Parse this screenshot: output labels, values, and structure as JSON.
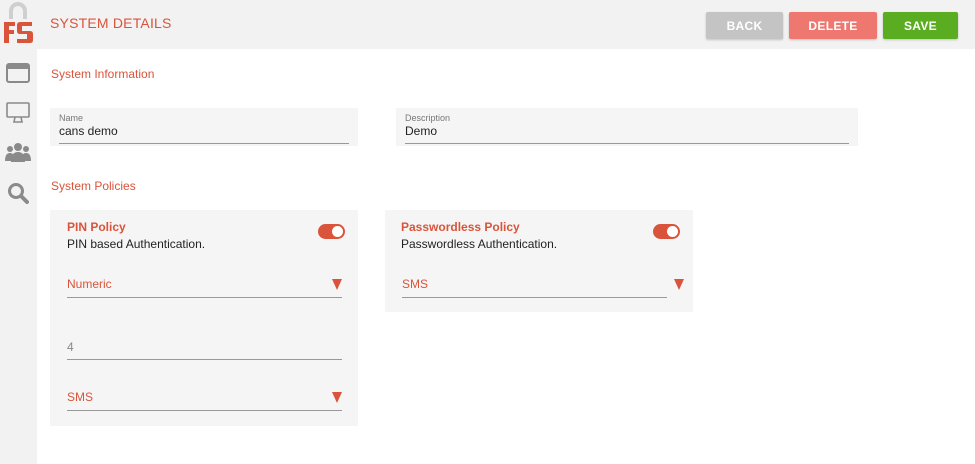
{
  "sidebar": {
    "logo_icon": "fs-logo",
    "items": [
      {
        "icon": "window-icon",
        "label": "Applications"
      },
      {
        "icon": "monitor-icon",
        "label": "Systems"
      },
      {
        "icon": "users-icon",
        "label": "Users"
      },
      {
        "icon": "search-icon",
        "label": "Search"
      }
    ]
  },
  "header": {
    "title": "SYSTEM DETAILS",
    "back_label": "BACK",
    "delete_label": "DELETE",
    "save_label": "SAVE"
  },
  "system_information": {
    "title": "System Information",
    "name_label": "Name",
    "name_value": "cans demo",
    "description_label": "Description",
    "description_value": "Demo"
  },
  "system_policies": {
    "title": "System Policies",
    "pin_policy": {
      "title": "PIN Policy",
      "description": "PIN based Authentication.",
      "enabled": true,
      "type_value": "Numeric",
      "length_value": "4",
      "method_value": "SMS"
    },
    "passwordless_policy": {
      "title": "Passwordless Policy",
      "description": "Passwordless Authentication.",
      "enabled": true,
      "method_value": "SMS"
    }
  },
  "colors": {
    "accent": "#d9543b",
    "back": "#c4c4c4",
    "delete": "#ee7770",
    "save": "#5aad20",
    "panel": "#f2f2f2"
  }
}
